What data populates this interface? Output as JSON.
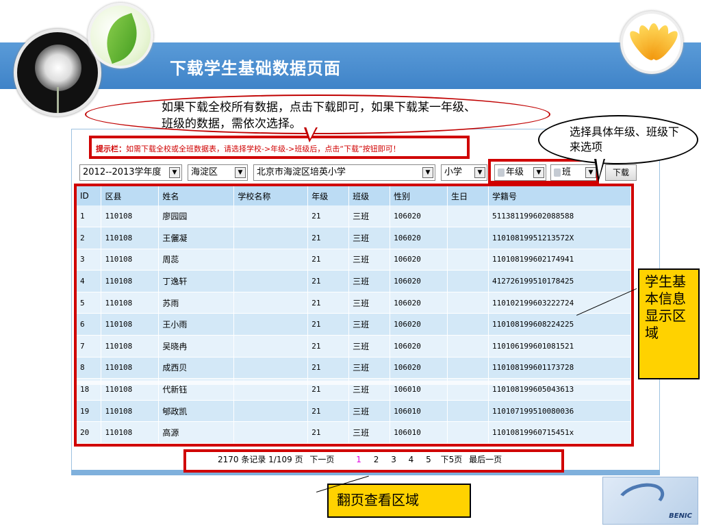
{
  "slide": {
    "title": "下载学生基础数据页面",
    "logo_text": "BENIC"
  },
  "hint": {
    "label": "提示栏：",
    "text": "如需下载全校或全班数据表，请选择学校->年级->班级后，点击“下载”按钮即可！"
  },
  "filters": {
    "year": "2012--2013学年度",
    "district": "海淀区",
    "school": "北京市海淀区培英小学",
    "level": "小学",
    "grade": "年级",
    "class": "班",
    "arrow_glyph": "▼",
    "download_label": "下载"
  },
  "table": {
    "headers": [
      "ID",
      "区县",
      "姓名",
      "学校名称",
      "年级",
      "班级",
      "性别",
      "生日",
      "学籍号"
    ],
    "rows": [
      [
        "1",
        "110108",
        "廖园园",
        "",
        "21",
        "三班",
        "106020",
        "",
        "511381199602088588"
      ],
      [
        "2",
        "110108",
        "王儷凝",
        "",
        "21",
        "三班",
        "106020",
        "",
        "11010819951213572X"
      ],
      [
        "3",
        "110108",
        "周蕊",
        "",
        "21",
        "三班",
        "106020",
        "",
        "110108199602174941"
      ],
      [
        "4",
        "110108",
        "丁逸轩",
        "",
        "21",
        "三班",
        "106020",
        "",
        "412726199510178425"
      ],
      [
        "5",
        "110108",
        "苏雨",
        "",
        "21",
        "三班",
        "106020",
        "",
        "110102199603222724"
      ],
      [
        "6",
        "110108",
        "王小雨",
        "",
        "21",
        "三班",
        "106020",
        "",
        "110108199608224225"
      ],
      [
        "7",
        "110108",
        "吴晓冉",
        "",
        "21",
        "三班",
        "106020",
        "",
        "110106199601081521"
      ],
      [
        "8",
        "110108",
        "成西贝",
        "",
        "21",
        "三班",
        "106020",
        "",
        "110108199601173728"
      ],
      [
        "18",
        "110108",
        "代新钰",
        "",
        "21",
        "三班",
        "106010",
        "",
        "110108199605043613"
      ],
      [
        "19",
        "110108",
        "郇政凯",
        "",
        "21",
        "三班",
        "106010",
        "",
        "110107199510080036"
      ],
      [
        "20",
        "110108",
        "高源",
        "",
        "21",
        "三班",
        "106010",
        "",
        "11010819960715451x"
      ]
    ]
  },
  "pager": {
    "summary": "2170 条记录 1/109 页",
    "prev": "下一页",
    "pages": [
      "1",
      "2",
      "3",
      "4",
      "5"
    ],
    "next5": "下5页",
    "last": "最后一页"
  },
  "callouts": {
    "download_all": "如果下载全校所有数据，点击下载即可，如果下载某一年级、班级的数据，需依次选择。",
    "select_grade": "选择具体年级、班级下来选项",
    "info_area": "学生基本信息显示区域",
    "paging_area": "翻页查看区域"
  }
}
